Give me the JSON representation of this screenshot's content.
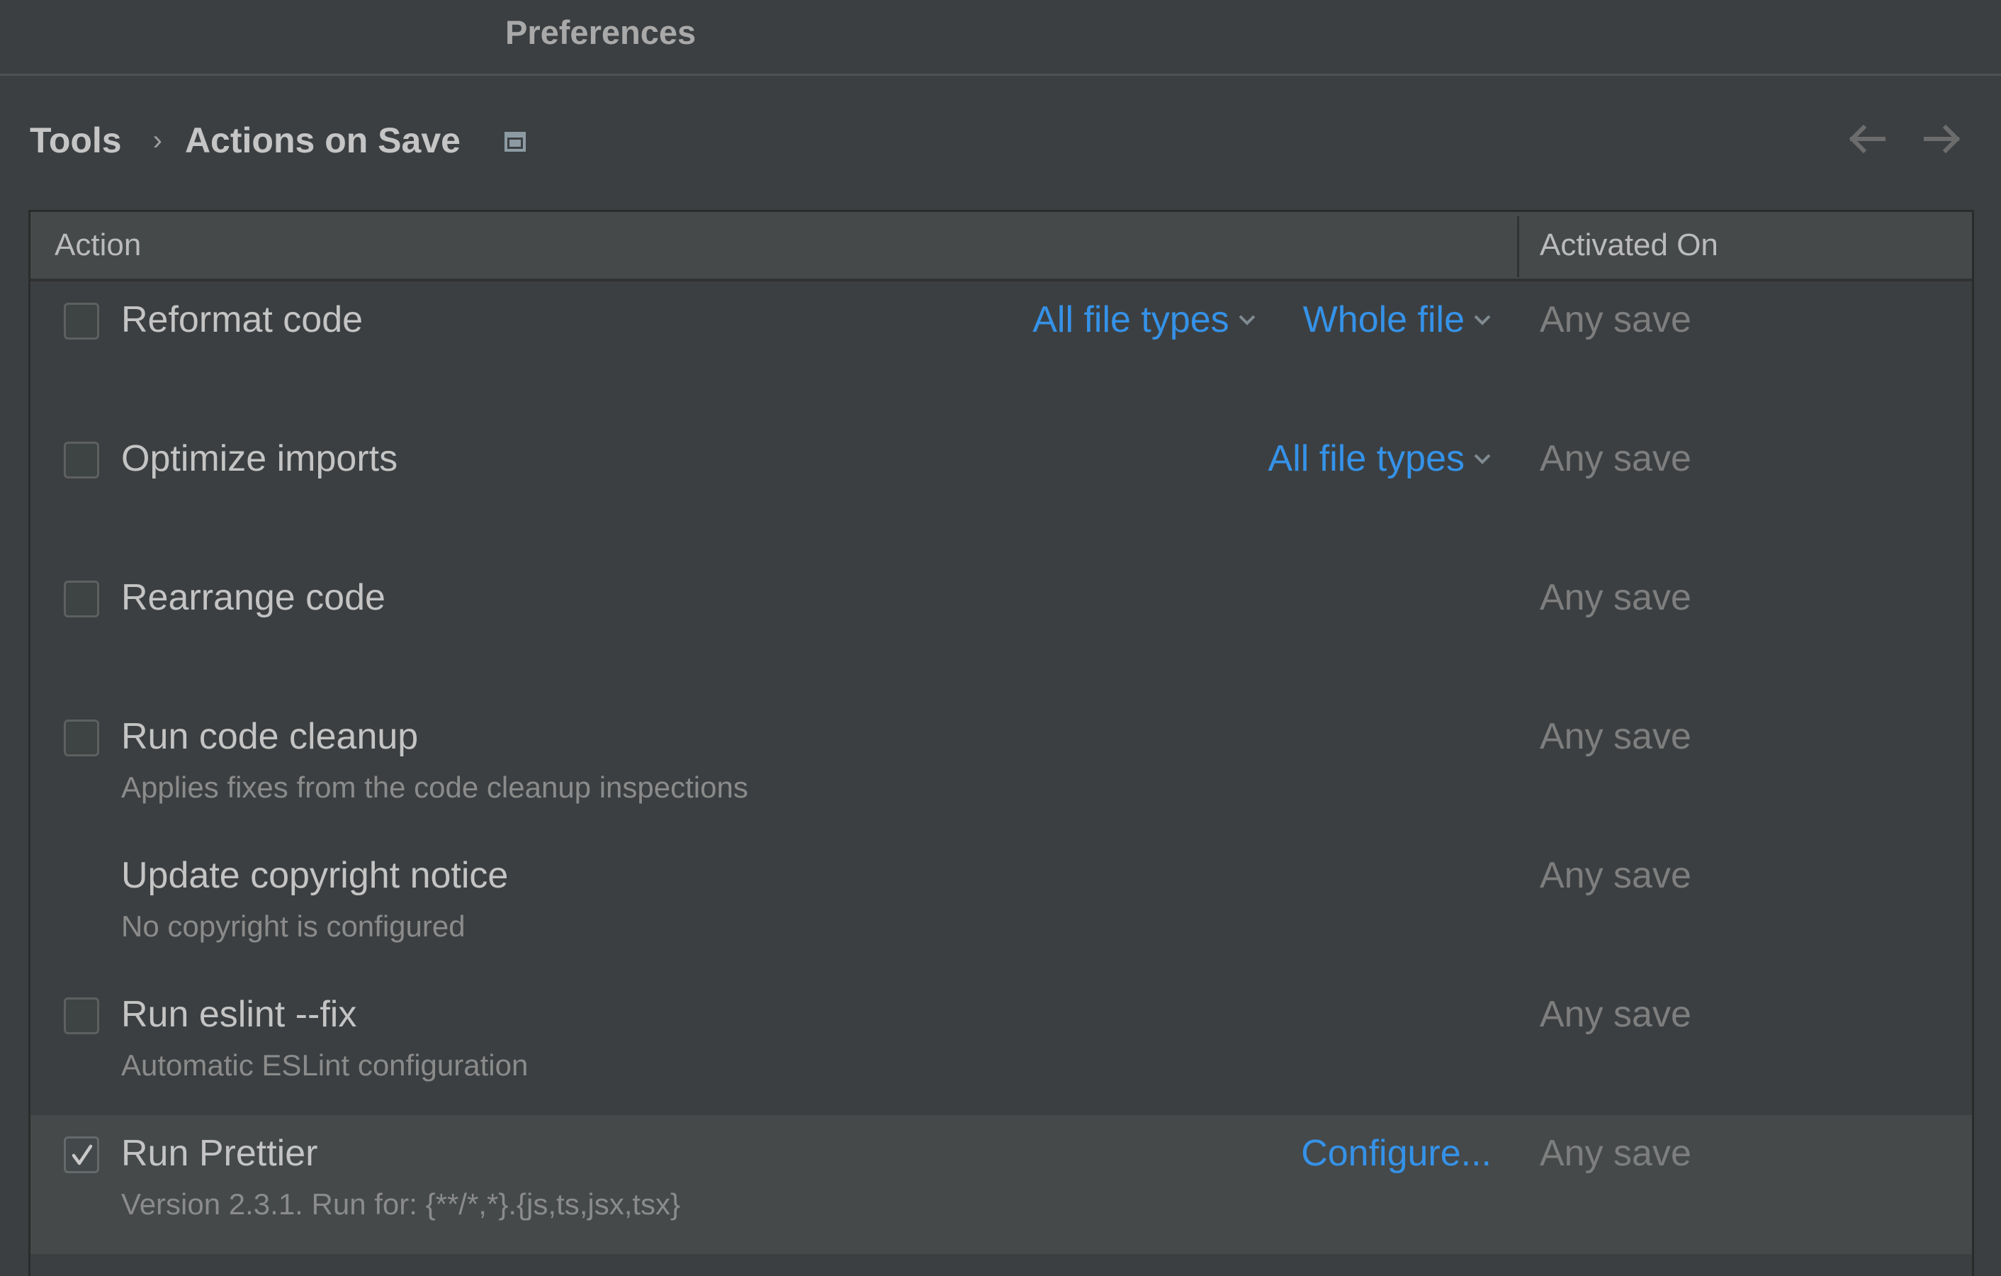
{
  "window": {
    "title": "Preferences"
  },
  "breadcrumb": {
    "parent": "Tools",
    "separator": "›",
    "current": "Actions on Save",
    "page_icon": "window-icon"
  },
  "navigation": {
    "back_icon": "arrow-left-icon",
    "forward_icon": "arrow-right-icon"
  },
  "table": {
    "columns": [
      "Action",
      "Activated On"
    ],
    "rows": [
      {
        "label": "Reformat code",
        "description": "",
        "checkbox": true,
        "checked": false,
        "options": [
          {
            "label": "All file types",
            "type": "dropdown"
          },
          {
            "label": "Whole file",
            "type": "dropdown"
          }
        ],
        "activated_on": "Any save"
      },
      {
        "label": "Optimize imports",
        "description": "",
        "checkbox": true,
        "checked": false,
        "options": [
          {
            "label": "All file types",
            "type": "dropdown"
          }
        ],
        "activated_on": "Any save"
      },
      {
        "label": "Rearrange code",
        "description": "",
        "checkbox": true,
        "checked": false,
        "options": [],
        "activated_on": "Any save"
      },
      {
        "label": "Run code cleanup",
        "description": "Applies fixes from the code cleanup inspections",
        "checkbox": true,
        "checked": false,
        "options": [],
        "activated_on": "Any save"
      },
      {
        "label": "Update copyright notice",
        "description": "No copyright is configured",
        "checkbox": false,
        "checked": false,
        "options": [],
        "activated_on": "Any save"
      },
      {
        "label": "Run eslint --fix",
        "description": "Automatic ESLint configuration",
        "checkbox": true,
        "checked": false,
        "options": [],
        "activated_on": "Any save"
      },
      {
        "label": "Run Prettier",
        "description": "Version 2.3.1. Run for: {**/*,*}.{js,ts,jsx,tsx}",
        "checkbox": true,
        "checked": true,
        "selected": true,
        "options": [
          {
            "label": "Configure...",
            "type": "link"
          }
        ],
        "activated_on": "Any save"
      }
    ]
  },
  "colors": {
    "background": "#3c3f41",
    "header_background": "#45494a",
    "selected_row": "#45494a",
    "link": "#3592e8",
    "text": "#c4c4c4",
    "muted_text": "#8b8b8b"
  }
}
